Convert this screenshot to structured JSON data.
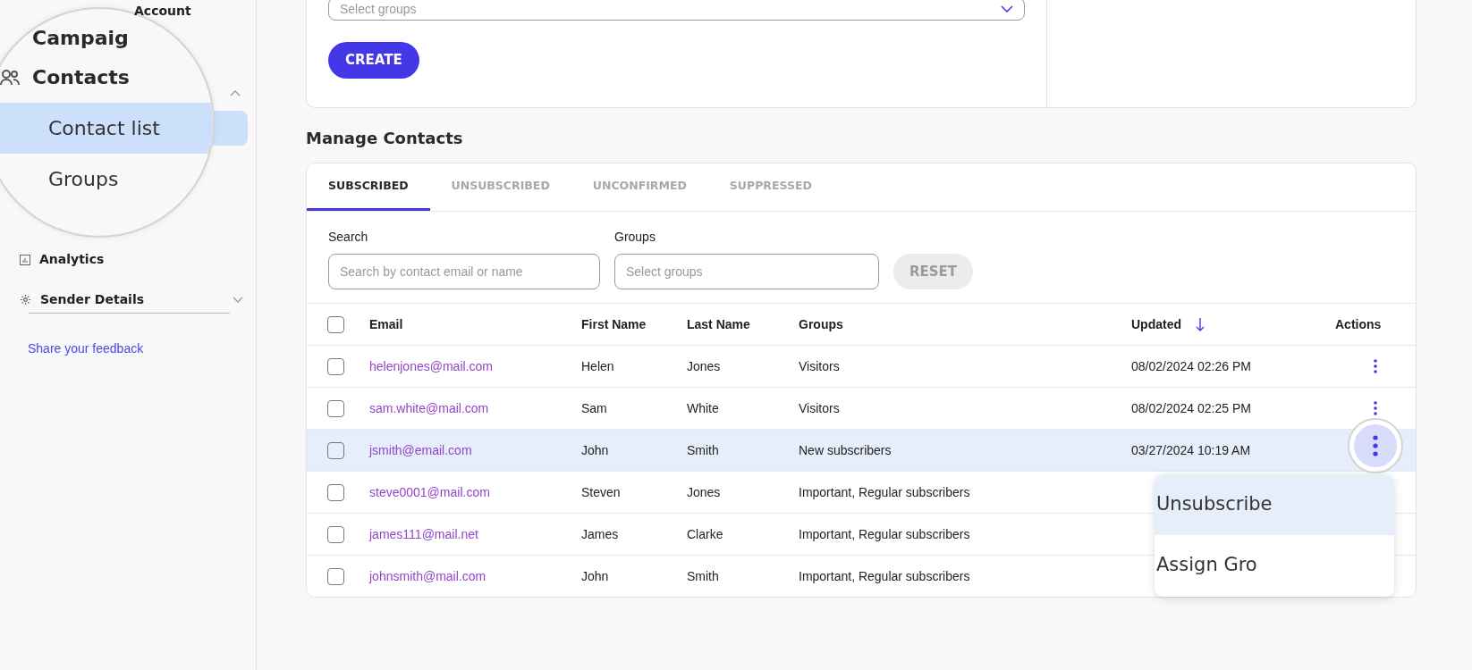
{
  "sidebar": {
    "back_link": "Account",
    "magnified_items": [
      {
        "label": "Campaig",
        "kind": "cut"
      },
      {
        "label": "Contacts",
        "kind": "heading",
        "expanded": true
      },
      {
        "label": "Contact list",
        "kind": "sub",
        "selected": true
      },
      {
        "label": "Groups",
        "kind": "sub",
        "selected": false
      }
    ],
    "items": [
      {
        "label": "Analytics",
        "kind": "analytics"
      },
      {
        "label": "Sender Details",
        "kind": "settings",
        "expanded": false
      }
    ],
    "feedback_link": "Share your feedback"
  },
  "create_form": {
    "groups_placeholder": "Select groups",
    "create_button": "CREATE"
  },
  "section_title": "Manage Contacts",
  "tabs": [
    {
      "label": "SUBSCRIBED",
      "selected": true
    },
    {
      "label": "UNSUBSCRIBED",
      "selected": false
    },
    {
      "label": "UNCONFIRMED",
      "selected": false
    },
    {
      "label": "SUPPRESSED",
      "selected": false
    }
  ],
  "filters": {
    "search_label": "Search",
    "search_placeholder": "Search by contact email or name",
    "groups_label": "Groups",
    "groups_placeholder": "Select groups",
    "reset_button": "RESET"
  },
  "table": {
    "columns": [
      "Email",
      "First Name",
      "Last Name",
      "Groups",
      "Updated",
      "Actions"
    ],
    "select_all_checked": false,
    "rows": [
      {
        "email": "helenjones@mail.com",
        "first": "Helen",
        "last": "Jones",
        "groups": "Visitors",
        "updated": "08/02/2024 02:26 PM",
        "checked": false,
        "selected": false
      },
      {
        "email": "sam.white@mail.com",
        "first": "Sam",
        "last": "White",
        "groups": "Visitors",
        "updated": "08/02/2024 02:25 PM",
        "checked": false,
        "selected": false
      },
      {
        "email": "jsmith@email.com",
        "first": "John",
        "last": "Smith",
        "groups": "New subscribers",
        "updated": "03/27/2024 10:19 AM",
        "checked": false,
        "selected": true
      },
      {
        "email": "steve0001@mail.com",
        "first": "Steven",
        "last": "Jones",
        "groups": "Important, Regular subscribers",
        "updated": "",
        "checked": false,
        "selected": false
      },
      {
        "email": "james111@mail.net",
        "first": "James",
        "last": "Clarke",
        "groups": "Important, Regular subscribers",
        "updated": "",
        "checked": false,
        "selected": false
      },
      {
        "email": "johnsmith@mail.com",
        "first": "John",
        "last": "Smith",
        "groups": "Important, Regular subscribers",
        "updated": "",
        "checked": false,
        "selected": false
      }
    ]
  },
  "action_menu": {
    "items": [
      {
        "label": "Unsubscribe",
        "selected": true
      },
      {
        "label": "Assign Gro",
        "selected": false
      }
    ]
  }
}
